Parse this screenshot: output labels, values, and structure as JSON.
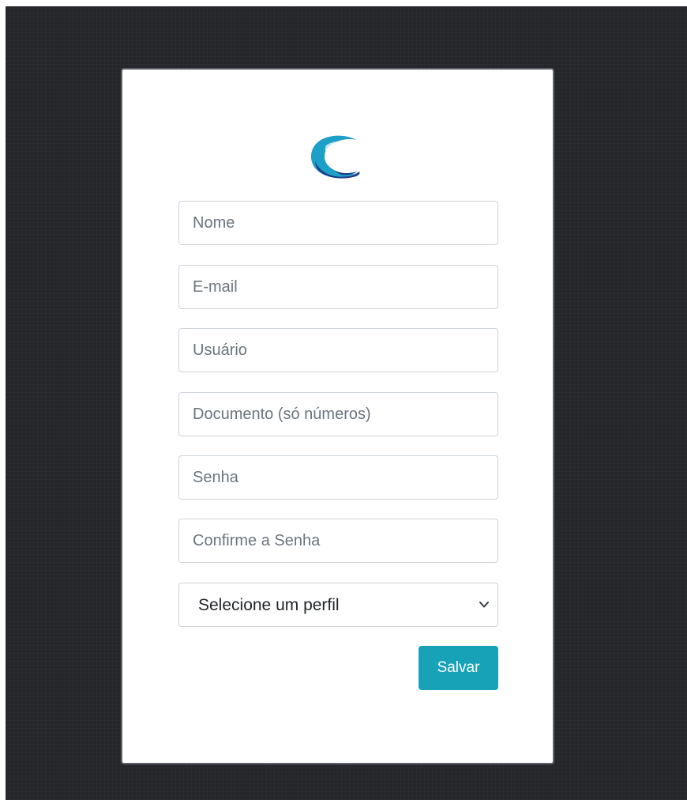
{
  "logo": {
    "icon": "c-wave-logo-icon",
    "colors": {
      "primary": "#1da0c8",
      "secondary": "#1f3d8a"
    }
  },
  "form": {
    "fields": [
      {
        "name": "nome",
        "placeholder": "Nome",
        "value": ""
      },
      {
        "name": "email",
        "placeholder": "E-mail",
        "value": ""
      },
      {
        "name": "usuario",
        "placeholder": "Usuário",
        "value": ""
      },
      {
        "name": "documento",
        "placeholder": "Documento (só números)",
        "value": ""
      },
      {
        "name": "senha",
        "placeholder": "Senha",
        "value": ""
      },
      {
        "name": "confirme-senha",
        "placeholder": "Confirme a Senha",
        "value": ""
      }
    ],
    "profile_select": {
      "selected": "Selecione um perfil",
      "icon": "chevron-down-icon"
    },
    "save_label": "Salvar"
  },
  "colors": {
    "background": "#24262a",
    "card": "#ffffff",
    "button": "#17a2b8",
    "field_border": "#ced4da",
    "placeholder": "#6c757d"
  }
}
